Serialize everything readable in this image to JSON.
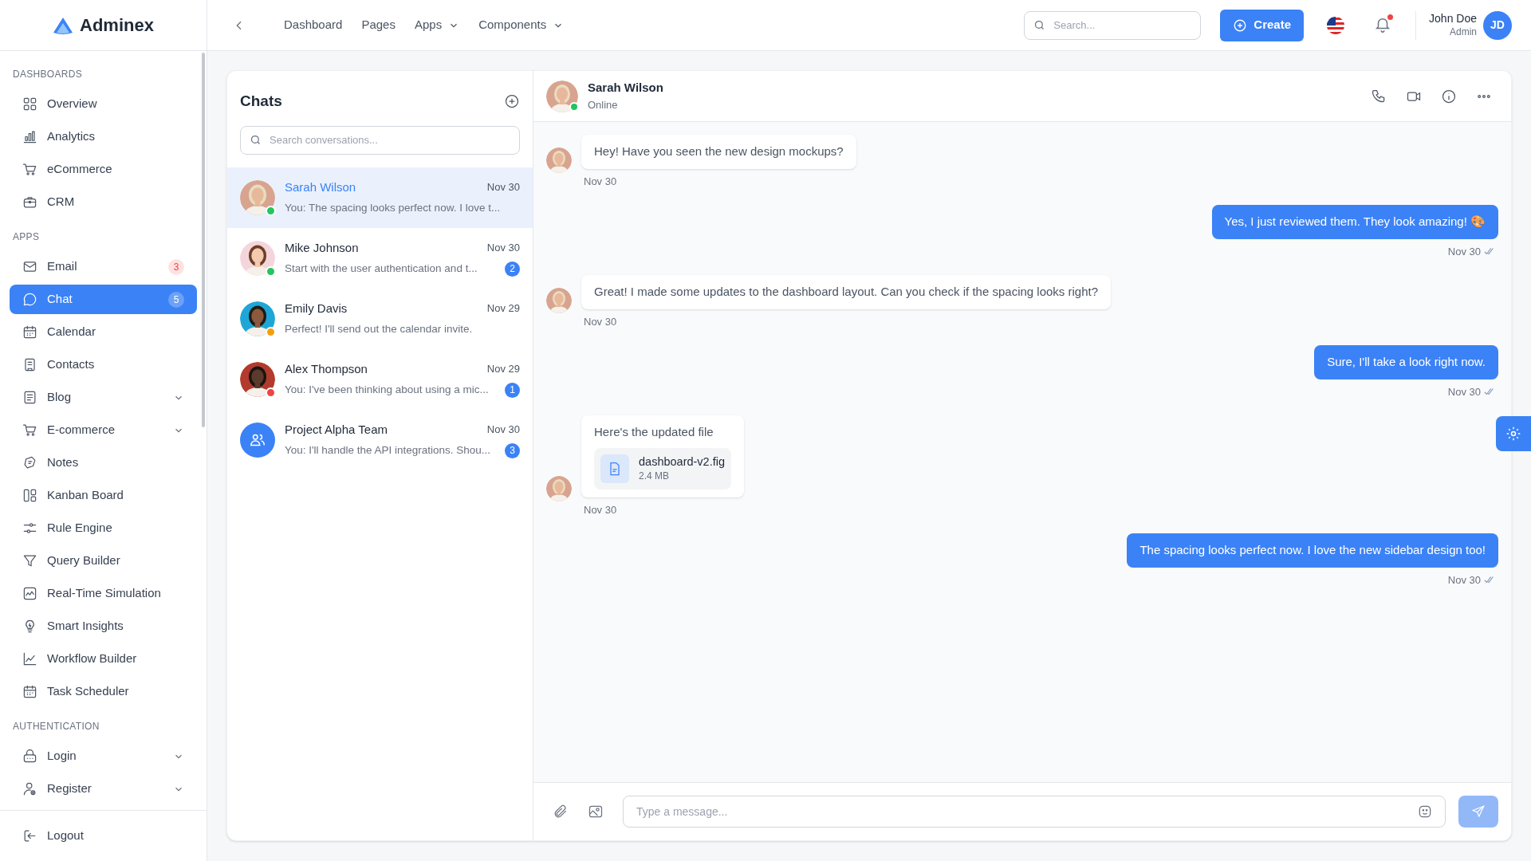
{
  "brand": {
    "name": "Adminex"
  },
  "sidebar": {
    "sections": [
      {
        "title": "DASHBOARDS",
        "items": [
          {
            "label": "Overview",
            "selected": false
          },
          {
            "label": "Analytics",
            "selected": false
          },
          {
            "label": "eCommerce",
            "selected": false
          },
          {
            "label": "CRM",
            "selected": false
          }
        ]
      },
      {
        "title": "APPS",
        "items": [
          {
            "label": "Email",
            "selected": false,
            "badge": "3"
          },
          {
            "label": "Chat",
            "selected": true,
            "badge": "5"
          },
          {
            "label": "Calendar",
            "selected": false
          },
          {
            "label": "Contacts",
            "selected": false
          },
          {
            "label": "Blog",
            "selected": false,
            "expanded": false
          },
          {
            "label": "E-commerce",
            "selected": false,
            "expanded": false
          },
          {
            "label": "Notes",
            "selected": false
          },
          {
            "label": "Kanban Board",
            "selected": false
          },
          {
            "label": "Rule Engine",
            "selected": false
          },
          {
            "label": "Query Builder",
            "selected": false
          },
          {
            "label": "Real-Time Simulation",
            "selected": false
          },
          {
            "label": "Smart Insights",
            "selected": false
          },
          {
            "label": "Workflow Builder",
            "selected": false
          },
          {
            "label": "Task Scheduler",
            "selected": false
          }
        ]
      },
      {
        "title": "AUTHENTICATION",
        "items": [
          {
            "label": "Login",
            "selected": false,
            "expanded": false
          },
          {
            "label": "Register",
            "selected": false,
            "expanded": false
          }
        ]
      }
    ],
    "footer": {
      "label": "Logout"
    }
  },
  "topbar": {
    "nav": [
      {
        "label": "Dashboard",
        "dropdown": false
      },
      {
        "label": "Pages",
        "dropdown": false
      },
      {
        "label": "Apps",
        "dropdown": true
      },
      {
        "label": "Components",
        "dropdown": true
      }
    ],
    "search": {
      "placeholder": "Search..."
    },
    "create": "Create",
    "notifications": true,
    "user": {
      "name": "John Doe",
      "role": "Admin",
      "initials": "JD"
    }
  },
  "chats": {
    "title": "Chats",
    "search": {
      "placeholder": "Search conversations..."
    },
    "items": [
      {
        "name": "Sarah Wilson",
        "date": "Nov 30",
        "preview": "You: The spacing looks perfect now. I love t...",
        "selected": true,
        "color": "#22c55e",
        "kind": "person"
      },
      {
        "name": "Mike Johnson",
        "date": "Nov 30",
        "preview": "Start with the user authentication and t...",
        "unread": "2",
        "selected": false,
        "color": "#22c55e",
        "kind": "person"
      },
      {
        "name": "Emily Davis",
        "date": "Nov 29",
        "preview": "Perfect! I'll send out the calendar invite.",
        "selected": false,
        "color": "#f59e0b",
        "kind": "person"
      },
      {
        "name": "Alex Thompson",
        "date": "Nov 29",
        "preview": "You: I've been thinking about using a mic...",
        "unread": "1",
        "selected": false,
        "color": "#ef4444",
        "kind": "person"
      },
      {
        "name": "Project Alpha Team",
        "date": "Nov 30",
        "preview": "You: I'll handle the API integrations. Shou...",
        "unread": "3",
        "selected": false,
        "kind": "group"
      }
    ]
  },
  "conversation": {
    "name": "Sarah Wilson",
    "status": "Online",
    "messages": [
      {
        "outgoing": false,
        "kind": "text",
        "text": "Hey! Have you seen the new design mockups?",
        "time": "Nov 30"
      },
      {
        "outgoing": true,
        "kind": "text",
        "text": "Yes, I just reviewed them. They look amazing! 🎨",
        "time": "Nov 30"
      },
      {
        "outgoing": false,
        "kind": "text",
        "text": "Great! I made some updates to the dashboard layout. Can you check if the spacing looks right?",
        "time": "Nov 30"
      },
      {
        "outgoing": true,
        "kind": "text",
        "text": "Sure, I'll take a look right now.",
        "time": "Nov 30"
      },
      {
        "outgoing": false,
        "kind": "file",
        "text": "Here's the updated file",
        "file": {
          "name": "dashboard-v2.fig",
          "size": "2.4 MB"
        },
        "time": "Nov 30"
      },
      {
        "outgoing": true,
        "kind": "text",
        "text": "The spacing looks perfect now. I love the new sidebar design too!",
        "time": "Nov 30"
      }
    ],
    "composer": {
      "placeholder": "Type a message..."
    }
  }
}
